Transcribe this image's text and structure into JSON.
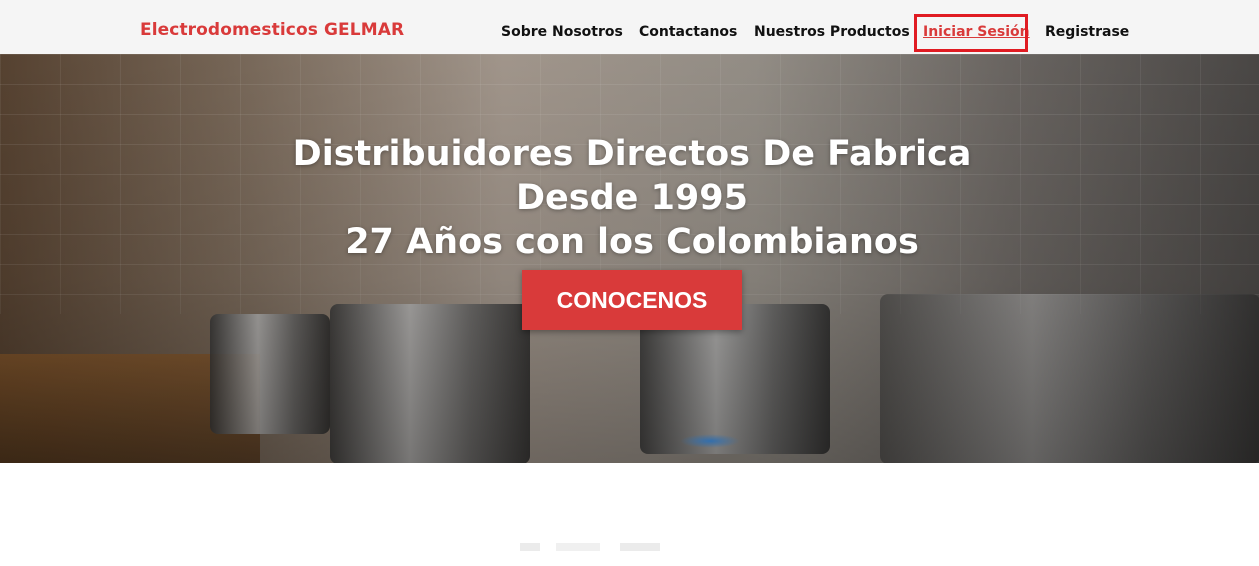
{
  "brand": "Electrodomesticos GELMAR",
  "nav": {
    "items": [
      {
        "label": "Sobre Nosotros"
      },
      {
        "label": "Contactanos"
      },
      {
        "label": "Nuestros Productos"
      },
      {
        "label": "Iniciar Sesión"
      },
      {
        "label": "Registrase"
      }
    ],
    "active_index": 3
  },
  "hero": {
    "line1": "Distribuidores Directos De Fabrica",
    "line2": "Desde 1995",
    "line3": "27 Años con los Colombianos",
    "cta_label": "CONOCENOS"
  },
  "colors": {
    "brand": "#d93a3a",
    "highlight_box": "#e01b22",
    "cta_bg": "#d93a3a",
    "navbar_bg": "#f5f5f5"
  }
}
